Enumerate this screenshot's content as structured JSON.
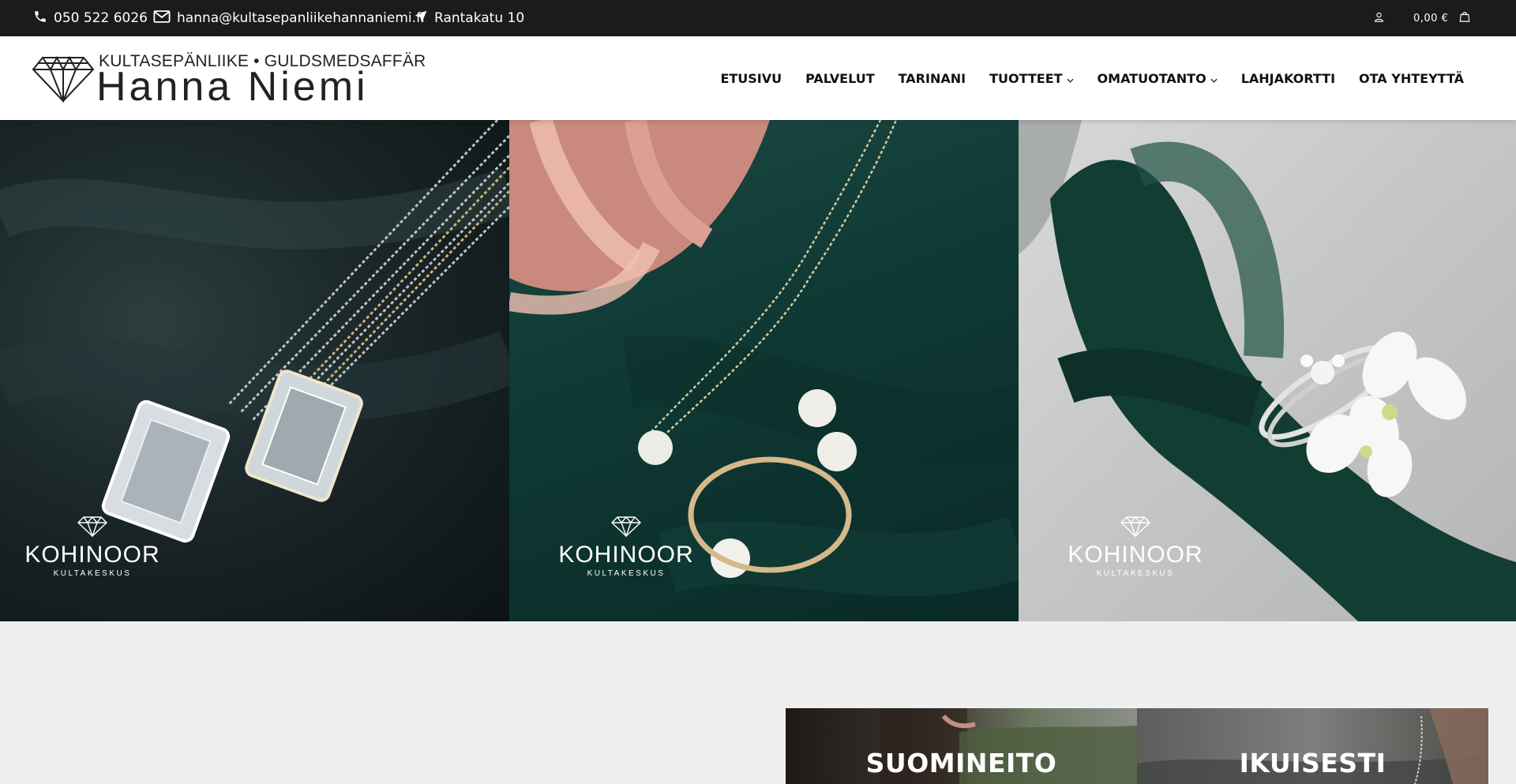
{
  "topbar": {
    "phone": "050 522 6026",
    "email": "hanna@kultasepanliikehannaniemi.fi",
    "address": "Rantakatu 10",
    "cart_total": "0,00 €"
  },
  "logo": {
    "tagline": "KULTASEPÄNLIIKE • GULDSMEDSAFFÄR",
    "name": "Hanna Niemi"
  },
  "nav": {
    "items": [
      {
        "label": "ETUSIVU"
      },
      {
        "label": "PALVELUT"
      },
      {
        "label": "TARINANI"
      },
      {
        "label": "TUOTTEET",
        "dropdown": true
      },
      {
        "label": "OMATUOTANTO",
        "dropdown": true
      },
      {
        "label": "LAHJAKORTTI"
      },
      {
        "label": "OTA YHTEYTTÄ"
      }
    ]
  },
  "hero": {
    "panels": [
      {
        "brand": "KOHINOOR",
        "brand_sub": "KULTAKESKUS"
      },
      {
        "brand": "KOHINOOR",
        "brand_sub": "KULTAKESKUS"
      },
      {
        "brand": "KOHINOOR",
        "brand_sub": "KULTAKESKUS"
      }
    ]
  },
  "cards": [
    {
      "title": "SUOMINEITO"
    },
    {
      "title": "IKUISESTI"
    }
  ],
  "colors": {
    "topbar_bg": "#1b1b1b",
    "header_bg": "#ffffff",
    "page_bg": "#efefef"
  }
}
